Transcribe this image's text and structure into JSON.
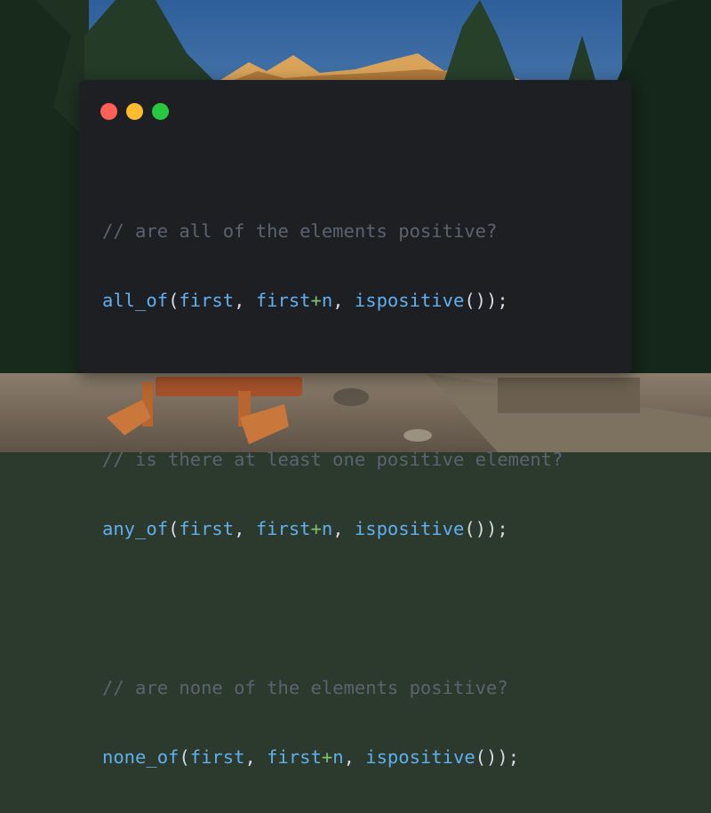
{
  "window_controls": {
    "close_color": "#ff5f57",
    "minimize_color": "#febc2e",
    "maximize_color": "#28c840"
  },
  "code_blocks": [
    {
      "comment": "// are all of the elements positive?",
      "func": "all_of",
      "open_paren": "(",
      "arg1": "first",
      "sep1": ", ",
      "arg2": "first",
      "plus": "+",
      "arg2b": "n",
      "sep2": ", ",
      "predicate": "ispositive",
      "tail": "());"
    },
    {
      "comment": "// is there at least one positive element?",
      "func": "any_of",
      "open_paren": "(",
      "arg1": "first",
      "sep1": ", ",
      "arg2": "first",
      "plus": "+",
      "arg2b": "n",
      "sep2": ", ",
      "predicate": "ispositive",
      "tail": "());"
    },
    {
      "comment": "// are none of the elements positive?",
      "func": "none_of",
      "open_paren": "(",
      "arg1": "first",
      "sep1": ", ",
      "arg2": "first",
      "plus": "+",
      "arg2b": "n",
      "sep2": ", ",
      "predicate": "ispositive",
      "tail": "());"
    }
  ]
}
